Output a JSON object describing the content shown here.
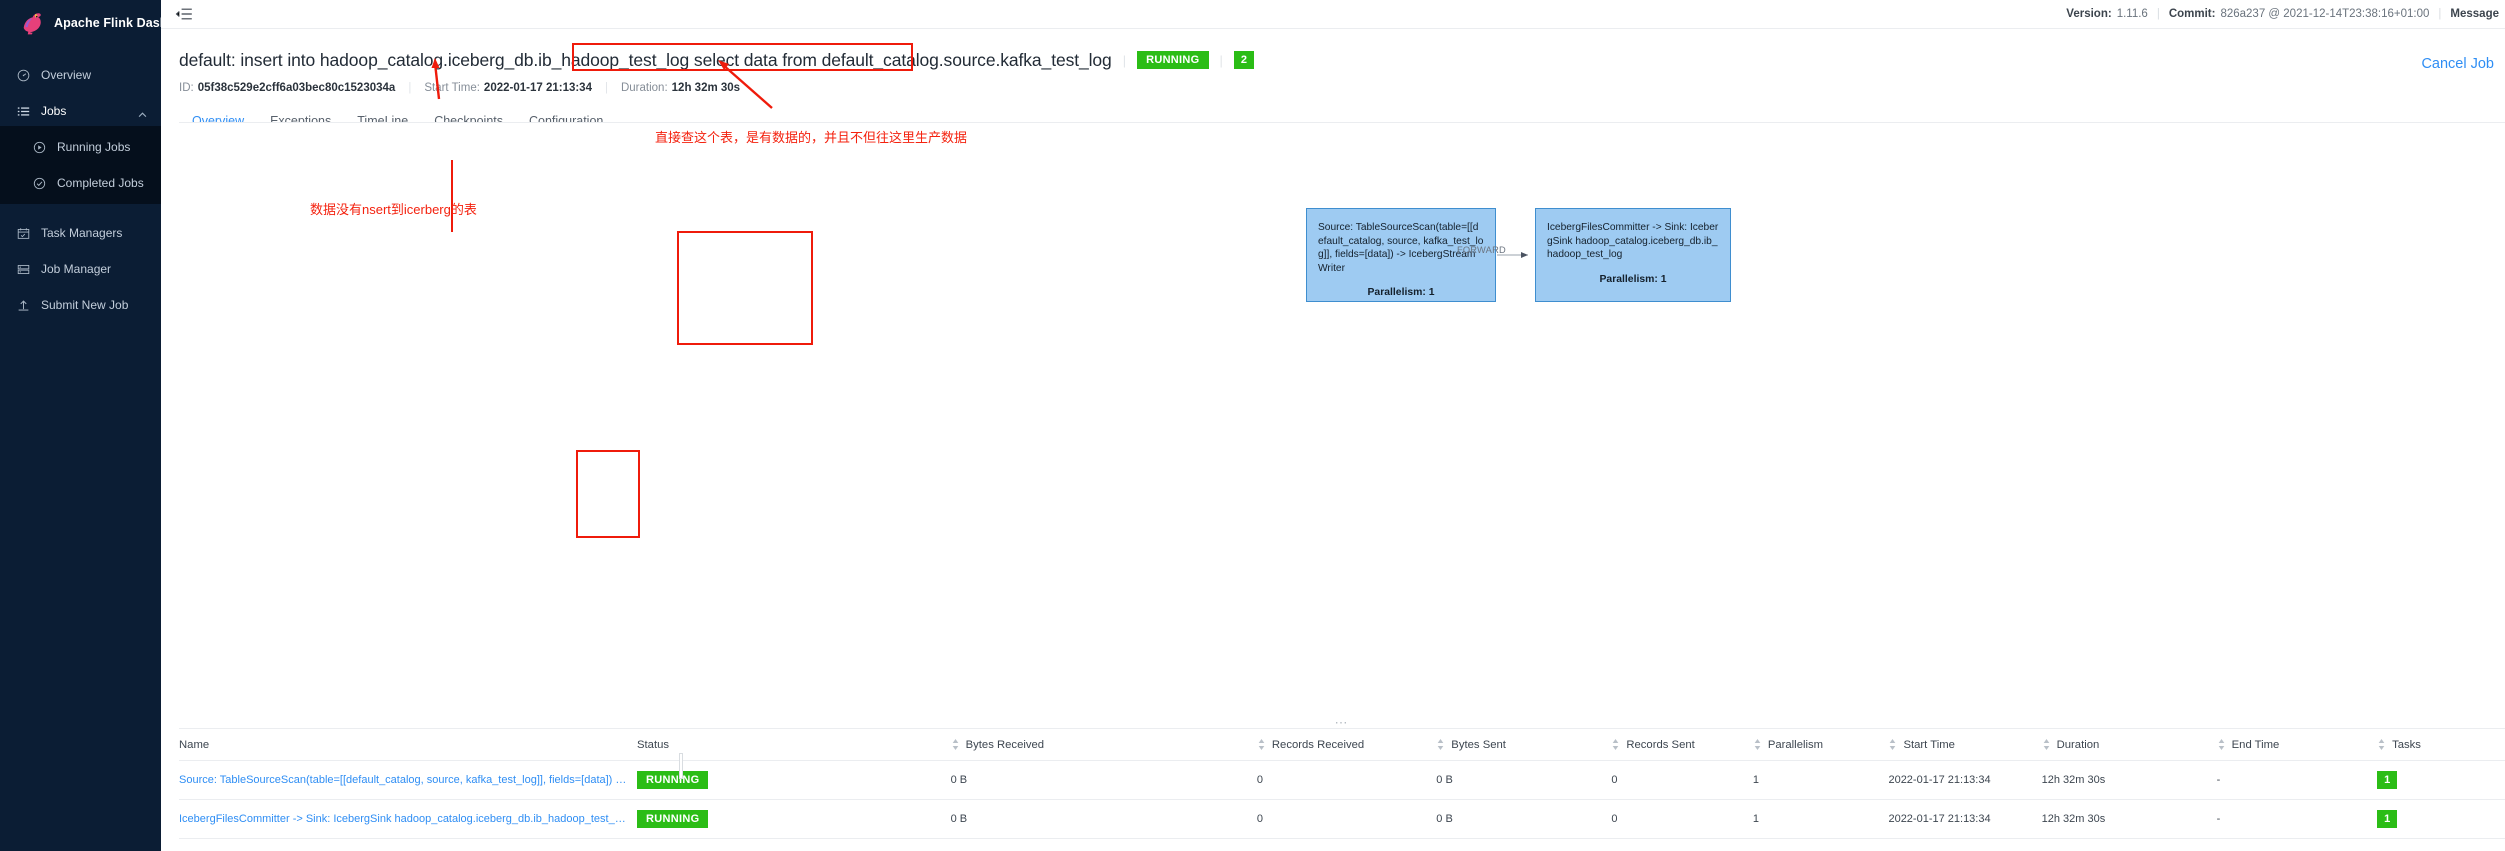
{
  "sidebar": {
    "brand": "Apache Flink Dashboard",
    "items": [
      {
        "label": "Overview",
        "icon": "gauge-icon",
        "level": "top"
      },
      {
        "label": "Jobs",
        "icon": "list-icon",
        "level": "top",
        "expanded": true
      },
      {
        "label": "Running Jobs",
        "icon": "play-circle-icon",
        "level": "sub"
      },
      {
        "label": "Completed Jobs",
        "icon": "check-circle-icon",
        "level": "sub"
      },
      {
        "label": "Task Managers",
        "icon": "calendar-check-icon",
        "level": "top"
      },
      {
        "label": "Job Manager",
        "icon": "server-icon",
        "level": "top"
      },
      {
        "label": "Submit New Job",
        "icon": "upload-icon",
        "level": "top"
      }
    ]
  },
  "topbar": {
    "menu_icon": "collapse-menu-icon",
    "version_key": "Version:",
    "version_value": "1.11.6",
    "commit_key": "Commit:",
    "commit_value": "826a237 @ 2021-12-14T23:38:16+01:00",
    "message_key": "Message"
  },
  "job": {
    "title": "default: insert into hadoop_catalog.iceberg_db.ib_hadoop_test_log select data from default_catalog.source.kafka_test_log",
    "status": "RUNNING",
    "task_count": "2",
    "id_label": "ID:",
    "id_value": "05f38c529e2cff6a03bec80c1523034a",
    "start_time_label": "Start Time:",
    "start_time_value": "2022-01-17 21:13:34",
    "duration_label": "Duration:",
    "duration_value": "12h 32m 30s",
    "cancel_label": "Cancel Job"
  },
  "tabs": [
    {
      "label": "Overview",
      "active": true
    },
    {
      "label": "Exceptions",
      "active": false
    },
    {
      "label": "TimeLine",
      "active": false
    },
    {
      "label": "Checkpoints",
      "active": false
    },
    {
      "label": "Configuration",
      "active": false
    }
  ],
  "graph": {
    "source_node": {
      "text": "Source: TableSourceScan(table=[[default_catalog, source, kafka_test_log]], fields=[data]) -> IcebergStreamWriter",
      "parallelism": "Parallelism: 1"
    },
    "sink_node": {
      "text": "IcebergFilesCommitter -> Sink: IcebergSink hadoop_catalog.iceberg_db.ib_hadoop_test_log",
      "parallelism": "Parallelism: 1"
    },
    "edge_label": "FORWARD"
  },
  "table": {
    "columns": [
      {
        "label": "Name",
        "sortable": false
      },
      {
        "label": "Status",
        "sortable": false
      },
      {
        "label": "Bytes Received",
        "sortable": true
      },
      {
        "label": "Records Received",
        "sortable": true
      },
      {
        "label": "Bytes Sent",
        "sortable": true
      },
      {
        "label": "Records Sent",
        "sortable": true
      },
      {
        "label": "Parallelism",
        "sortable": true
      },
      {
        "label": "Start Time",
        "sortable": true
      },
      {
        "label": "Duration",
        "sortable": true
      },
      {
        "label": "End Time",
        "sortable": true
      },
      {
        "label": "Tasks",
        "sortable": true
      }
    ],
    "rows": [
      {
        "name": "Source: TableSourceScan(table=[[default_catalog, source, kafka_test_log]], fields=[data]) -> ...",
        "status": "RUNNING",
        "bytes_received": "0 B",
        "records_received": "0",
        "bytes_sent": "0 B",
        "records_sent": "0",
        "parallelism": "1",
        "start_time": "2022-01-17 21:13:34",
        "duration": "12h 32m 30s",
        "end_time": "-",
        "tasks": "1"
      },
      {
        "name": "IcebergFilesCommitter -> Sink: IcebergSink hadoop_catalog.iceberg_db.ib_hadoop_test_log",
        "status": "RUNNING",
        "bytes_received": "0 B",
        "records_received": "0",
        "bytes_sent": "0 B",
        "records_sent": "0",
        "parallelism": "1",
        "start_time": "2022-01-17 21:13:34",
        "duration": "12h 32m 30s",
        "end_time": "-",
        "tasks": "1"
      }
    ]
  },
  "annotations": [
    {
      "text": "直接查这个表，是有数据的，并且不但往这里生产数据"
    },
    {
      "text": "数据没有nsert到icerberg的表"
    }
  ],
  "colors": {
    "accent_blue": "#2f8ef4",
    "status_green": "#2bbd16",
    "annotation_red": "#f4220f",
    "sidebar_bg": "#0b1d34",
    "node_fill": "#9ecbf2",
    "node_border": "#3f8ecf"
  }
}
